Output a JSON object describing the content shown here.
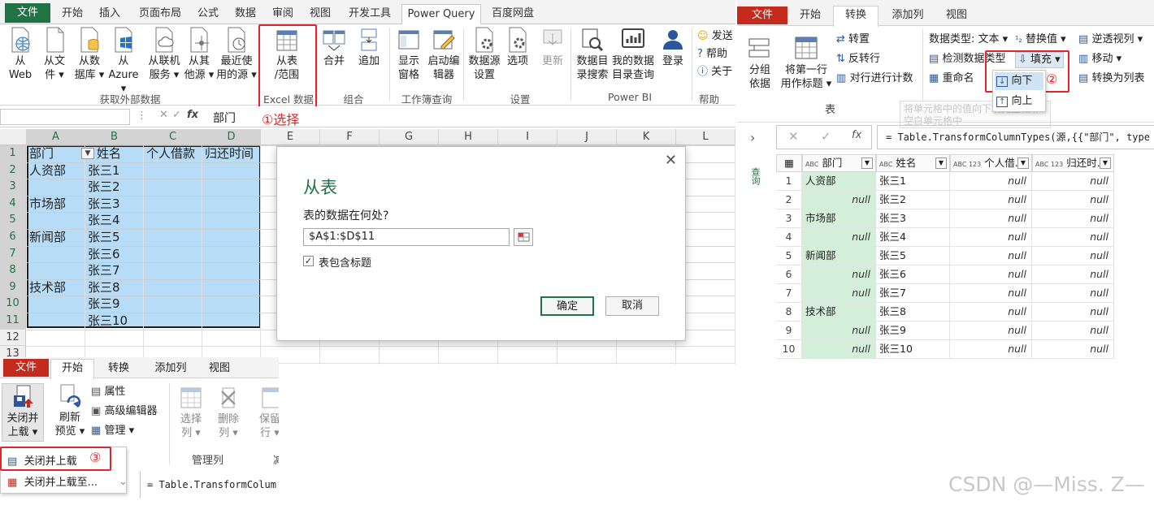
{
  "excel": {
    "tabs": [
      "文件",
      "开始",
      "插入",
      "页面布局",
      "公式",
      "数据",
      "审阅",
      "视图",
      "开发工具",
      "Power Query",
      "百度网盘"
    ],
    "ribbon": {
      "buttons": [
        {
          "l1": "从",
          "l2": "Web"
        },
        {
          "l1": "从文",
          "l2": "件 ▾"
        },
        {
          "l1": "从数",
          "l2": "据库 ▾"
        },
        {
          "l1": "从",
          "l2": "Azure ▾"
        },
        {
          "l1": "从联机",
          "l2": "服务 ▾"
        },
        {
          "l1": "从其",
          "l2": "他源 ▾"
        },
        {
          "l1": "最近使",
          "l2": "用的源 ▾"
        },
        {
          "l1": "从表",
          "l2": "/范围"
        },
        {
          "l1": "合并",
          "l2": ""
        },
        {
          "l1": "追加",
          "l2": ""
        },
        {
          "l1": "显示",
          "l2": "窗格"
        },
        {
          "l1": "启动编",
          "l2": "辑器"
        },
        {
          "l1": "数据源",
          "l2": "设置"
        },
        {
          "l1": "选项",
          "l2": ""
        },
        {
          "l1": "更新",
          "l2": ""
        },
        {
          "l1": "数据目",
          "l2": "录搜索"
        },
        {
          "l1": "我的数据",
          "l2": "目录查询"
        },
        {
          "l1": "登录",
          "l2": ""
        }
      ],
      "side": [
        "发送",
        "帮助",
        "关于"
      ],
      "groups": [
        "获取外部数据",
        "Excel 数据",
        "组合",
        "工作簿查询",
        "设置",
        "Power BI",
        "帮助"
      ]
    },
    "annotation1": "①选择",
    "namebox": "",
    "formula_fx": "fx",
    "formula_value": "部门",
    "columns": [
      "A",
      "B",
      "C",
      "D",
      "E",
      "F",
      "G",
      "H",
      "I",
      "J",
      "K",
      "L"
    ],
    "rows": [
      "1",
      "2",
      "3",
      "4",
      "5",
      "6",
      "7",
      "8",
      "9",
      "10",
      "11",
      "12",
      "13"
    ],
    "header_cells": [
      "部门",
      "姓名",
      "个人借款",
      "归还时间"
    ],
    "dept_cells": [
      {
        "row": 2,
        "v": "人资部"
      },
      {
        "row": 4,
        "v": "市场部"
      },
      {
        "row": 6,
        "v": "新闻部"
      },
      {
        "row": 9,
        "v": "技术部"
      }
    ],
    "name_cells": [
      "张三1",
      "张三2",
      "张三3",
      "张三4",
      "张三5",
      "张三6",
      "张三7",
      "张三8",
      "张三9",
      "张三10"
    ]
  },
  "dialog": {
    "title": "从表",
    "question": "表的数据在何处?",
    "range": "$A$1:$D$11",
    "checkbox_label": "表包含标题",
    "ok": "确定",
    "cancel": "取消"
  },
  "pq_bottom": {
    "tabs": [
      "文件",
      "开始",
      "转换",
      "添加列",
      "视图"
    ],
    "close_load_l1": "关闭并",
    "close_load_l2": "上载 ▾",
    "refresh_l1": "刷新",
    "refresh_l2": "预览 ▾",
    "properties": "属性",
    "adv_editor": "高级编辑器",
    "manage": "管理 ▾",
    "select_col_l1": "选择",
    "select_col_l2": "列 ▾",
    "remove_col_l1": "删除",
    "remove_col_l2": "列 ▾",
    "keep_l1": "保留",
    "keep_l2": "行 ▾",
    "group_manage": "管理列",
    "group_cut": "减",
    "menu_close_load": "关闭并上载",
    "annotation3": "③",
    "menu_close_load_to": "关闭并上载至...",
    "formula": "= Table.TransformColum"
  },
  "pq_editor": {
    "tabs": [
      "文件",
      "开始",
      "转换",
      "添加列",
      "视图"
    ],
    "group_by_l1": "分组",
    "group_by_l2": "依据",
    "first_row_l1": "将第一行",
    "first_row_l2": "用作标题 ▾",
    "transpose": "转置",
    "reverse_rows": "反转行",
    "count_rows": "对行进行计数",
    "group_table": "表",
    "data_type": "数据类型: 文本 ▾",
    "detect_type": "检测数据类型",
    "rename": "重命名",
    "replace_values": "替换值 ▾",
    "fill": "填充 ▾",
    "unpivot": "逆透视列 ▾",
    "move": "移动 ▾",
    "to_list": "转换为列表",
    "fill_down": "向下",
    "annotation2": "②",
    "fill_up": "向上",
    "tooltip": "将单元格中的值向下填充至相邻空白单元格中",
    "queries_label": "查询",
    "formula": "= Table.TransformColumnTypes(源,{{\"部门\", type",
    "col_headers": [
      "部门",
      "姓名",
      "个人借...",
      "归还时..."
    ],
    "col_types": [
      "ABC",
      "ABC",
      "ABC\n123",
      "ABC\n123"
    ],
    "rows": [
      {
        "n": "1",
        "dept": "人资部",
        "name": "张三1"
      },
      {
        "n": "2",
        "dept": "null",
        "name": "张三2"
      },
      {
        "n": "3",
        "dept": "市场部",
        "name": "张三3"
      },
      {
        "n": "4",
        "dept": "null",
        "name": "张三4"
      },
      {
        "n": "5",
        "dept": "新闻部",
        "name": "张三5"
      },
      {
        "n": "6",
        "dept": "null",
        "name": "张三6"
      },
      {
        "n": "7",
        "dept": "null",
        "name": "张三7"
      },
      {
        "n": "8",
        "dept": "技术部",
        "name": "张三8"
      },
      {
        "n": "9",
        "dept": "null",
        "name": "张三9"
      },
      {
        "n": "10",
        "dept": "null",
        "name": "张三10"
      }
    ],
    "null_text": "null"
  },
  "watermark": "CSDN @—Miss. Z—",
  "colors": {
    "excel_green": "#217346",
    "pq_red": "#c42b1c",
    "annot_red": "#e0262c",
    "sel_blue": "#b7dcf7"
  }
}
